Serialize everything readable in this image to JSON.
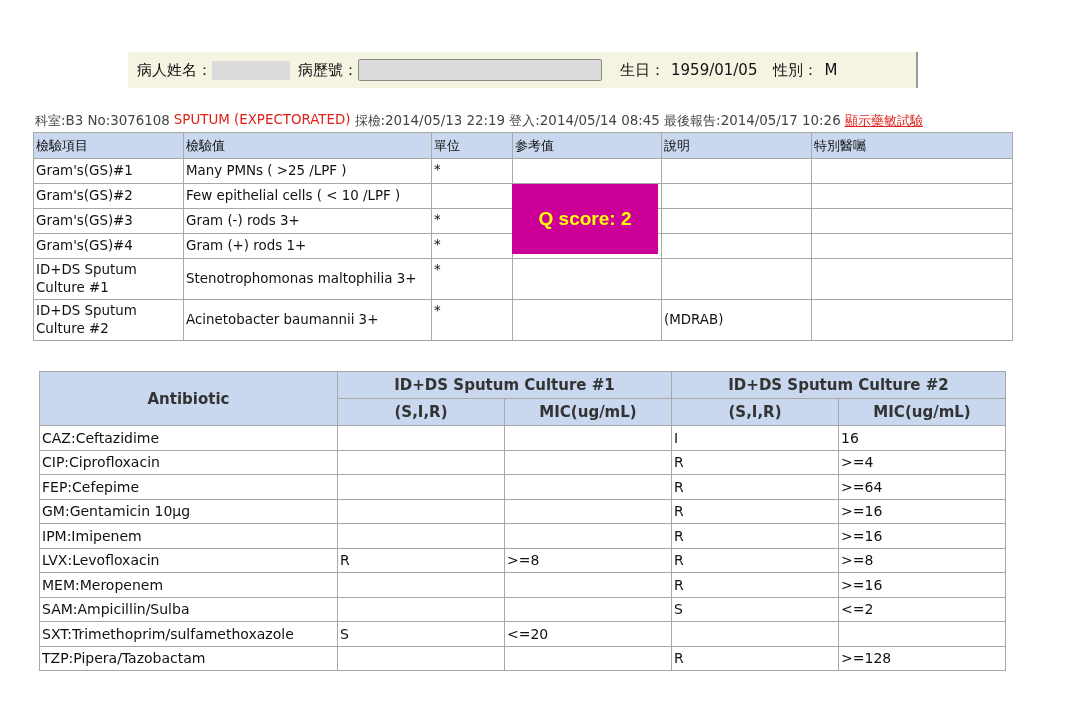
{
  "patient_bar": {
    "name_label": "病人姓名：",
    "chart_no_label": "病歷號：",
    "birth_label": "生日：",
    "birth_value": "1959/01/05",
    "sex_label": "性別：",
    "sex_value": "M"
  },
  "specimen_line": {
    "dept": "科室:B3 No:3076108",
    "specimen": "SPUTUM (EXPECTORATED)",
    "times": "採檢:2014/05/13 22:19 登入:2014/05/14 08:45 最後報告:2014/05/17 10:26",
    "link": "顯示藥敏試驗"
  },
  "lab_table": {
    "columns": [
      "檢驗項目",
      "檢驗值",
      "單位",
      "参考值",
      "說明",
      "特別醫囑"
    ],
    "rows": [
      [
        "Gram's(GS)#1",
        "Many PMNs ( >25 /LPF )",
        "*",
        null,
        null,
        null
      ],
      [
        "Gram's(GS)#2",
        "Few epithelial cells ( < 10 /LPF )",
        null,
        null,
        null,
        null
      ],
      [
        "Gram's(GS)#3",
        "Gram (-) rods 3+",
        "*",
        null,
        null,
        null
      ],
      [
        "Gram's(GS)#4",
        "Gram (+) rods 1+",
        "*",
        null,
        null,
        null
      ],
      [
        "ID+DS Sputum Culture #1",
        "Stenotrophomonas maltophilia 3+",
        "*",
        null,
        null,
        null
      ],
      [
        "ID+DS Sputum Culture #2",
        "Acinetobacter baumannii 3+",
        "*",
        null,
        "(MDRAB)",
        null
      ]
    ]
  },
  "q_score": "Q score: 2",
  "antibiotic_table": {
    "corner": "Antibiotic",
    "groups": [
      {
        "title": "ID+DS Sputum Culture #1",
        "columns": [
          "(S,I,R)",
          "MIC(ug/mL)"
        ]
      },
      {
        "title": "ID+DS Sputum Culture #2",
        "columns": [
          "(S,I,R)",
          "MIC(ug/mL)"
        ]
      }
    ],
    "rows": [
      [
        "CAZ:Ceftazidime",
        null,
        null,
        "I",
        "16"
      ],
      [
        "CIP:Ciprofloxacin",
        null,
        null,
        "R",
        ">=4"
      ],
      [
        "FEP:Cefepime",
        null,
        null,
        "R",
        ">=64"
      ],
      [
        "GM:Gentamicin 10µg",
        null,
        null,
        "R",
        ">=16"
      ],
      [
        "IPM:Imipenem",
        null,
        null,
        "R",
        ">=16"
      ],
      [
        "LVX:Levofloxacin",
        "R",
        ">=8",
        "R",
        ">=8"
      ],
      [
        "MEM:Meropenem",
        null,
        null,
        "R",
        ">=16"
      ],
      [
        "SAM:Ampicillin/Sulba",
        null,
        null,
        "S",
        "<=2"
      ],
      [
        "SXT:Trimethoprim/sulfamethoxazole",
        "S",
        "<=20",
        null,
        null
      ],
      [
        "TZP:Pipera/Tazobactam",
        null,
        null,
        "R",
        ">=128"
      ]
    ]
  }
}
